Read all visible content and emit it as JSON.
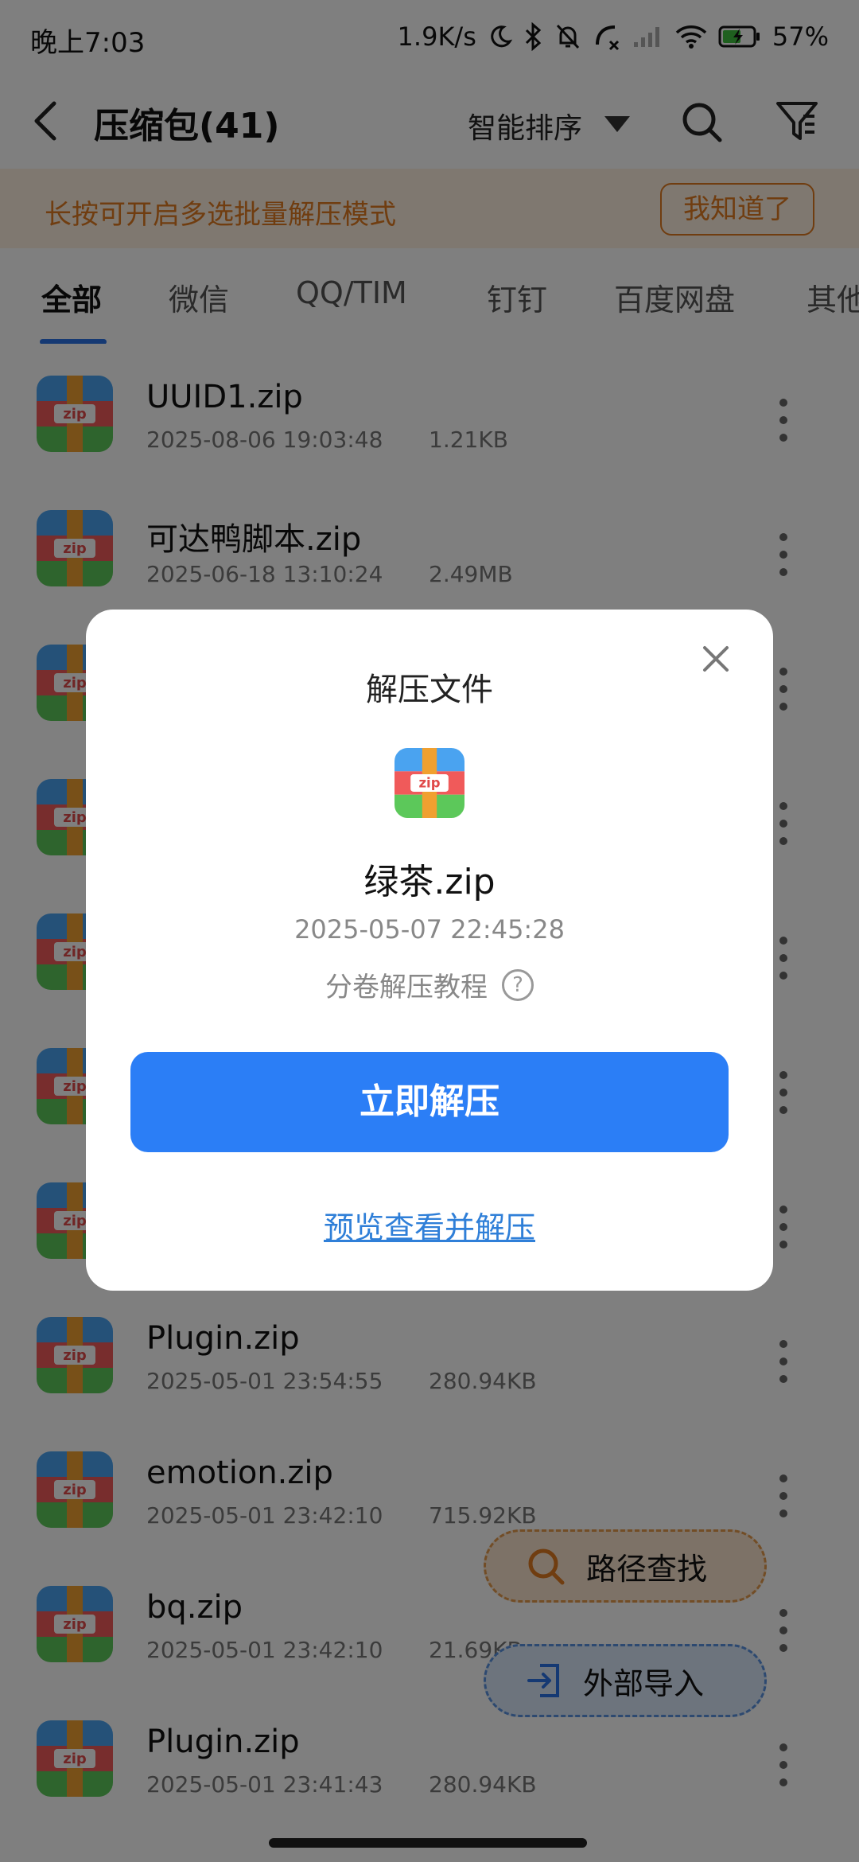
{
  "status_bar": {
    "time": "晚上7:03",
    "network_speed": "1.9K/s",
    "battery": "57%",
    "icons": [
      "moon-icon",
      "bluetooth-icon",
      "mute-bell-icon",
      "call-forward-icon",
      "cellular-signal-icon",
      "wifi-icon",
      "battery-charging-icon"
    ]
  },
  "header": {
    "title": "压缩包(41)",
    "sort_label": "智能排序",
    "icons": [
      "back-icon",
      "search-icon",
      "filter-icon"
    ]
  },
  "tip": {
    "text": "长按可开启多选批量解压模式",
    "button": "我知道了"
  },
  "tabs": [
    {
      "label": "全部",
      "active": true
    },
    {
      "label": "微信",
      "active": false
    },
    {
      "label": "QQ/TIM",
      "active": false
    },
    {
      "label": "钉钉",
      "active": false
    },
    {
      "label": "百度网盘",
      "active": false
    },
    {
      "label": "其他",
      "active": false
    }
  ],
  "files": [
    {
      "name": "UUID1.zip",
      "date": "2025-08-06 19:03:48",
      "size": "1.21KB"
    },
    {
      "name": "可达鸭脚本.zip",
      "date": "2025-06-18 13:10:24",
      "size": "2.49MB"
    },
    {
      "name": "",
      "date": "",
      "size": ""
    },
    {
      "name": "",
      "date": "",
      "size": ""
    },
    {
      "name": "",
      "date": "",
      "size": ""
    },
    {
      "name": "",
      "date": "",
      "size": ""
    },
    {
      "name": "",
      "date": "",
      "size": ""
    },
    {
      "name": "Plugin.zip",
      "date": "2025-05-01 23:54:55",
      "size": "280.94KB"
    },
    {
      "name": "emotion.zip",
      "date": "2025-05-01 23:42:10",
      "size": "715.92KB"
    },
    {
      "name": "bq.zip",
      "date": "2025-05-01 23:42:10",
      "size": "21.69KB"
    },
    {
      "name": "Plugin.zip",
      "date": "2025-05-01 23:41:43",
      "size": "280.94KB"
    }
  ],
  "fabs": {
    "path_search": "路径查找",
    "external_import": "外部导入"
  },
  "dialog": {
    "title": "解压文件",
    "filename": "绿茶.zip",
    "date": "2025-05-07 22:45:28",
    "help_text": "分卷解压教程",
    "help_mark": "?",
    "primary_button": "立即解压",
    "secondary_link": "预览查看并解压"
  },
  "colors": {
    "accent": "#2b7ef6",
    "tip_orange": "#e07a20",
    "link_blue": "#2f7fd8",
    "zip_blue": "#4aa3f0",
    "zip_red": "#f05a5a",
    "zip_green": "#5cc85a",
    "zip_orange": "#f0a030"
  }
}
